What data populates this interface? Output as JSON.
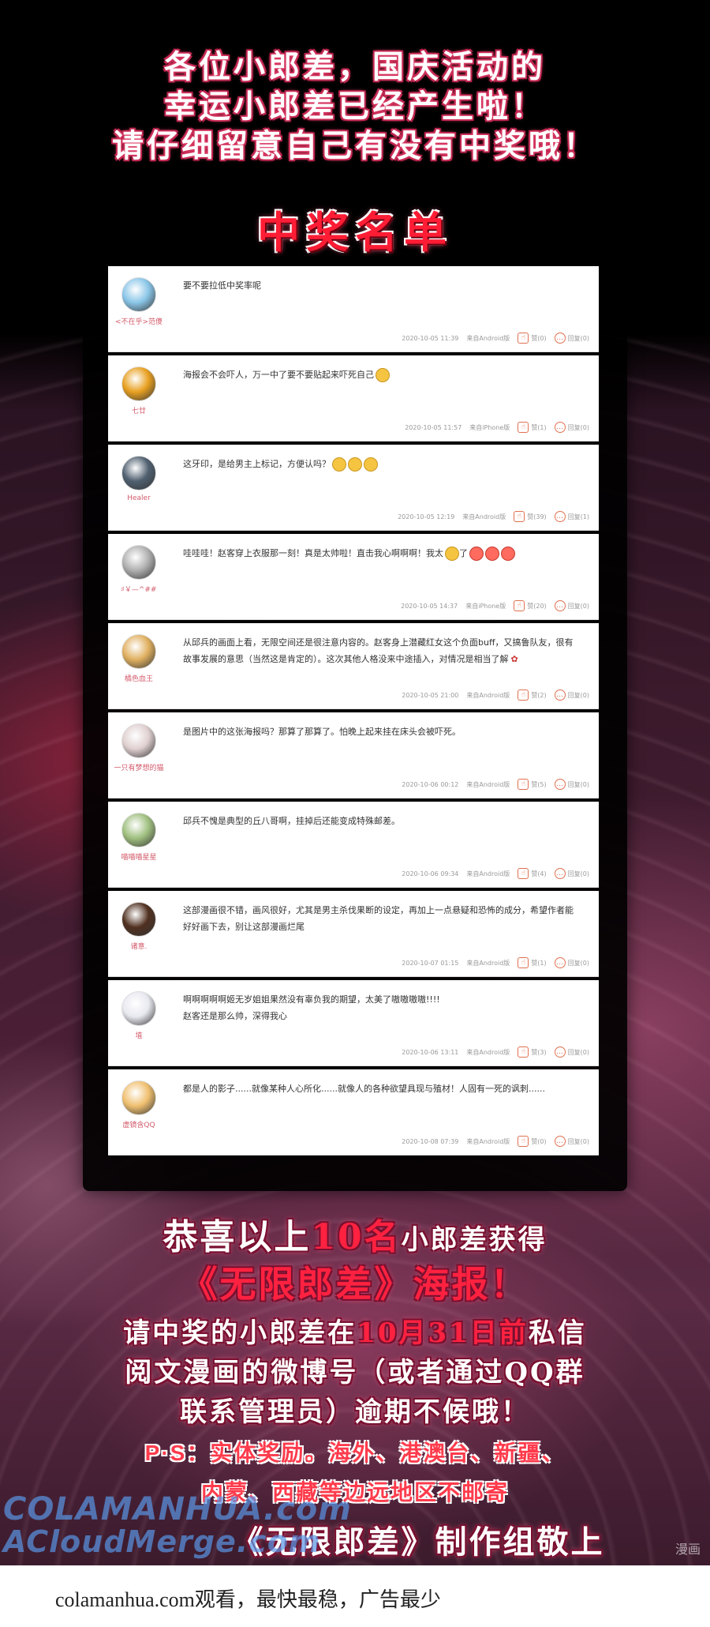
{
  "header": {
    "line1": "各位小郎差，国庆活动的",
    "line2": "幸运小郎差已经产生啦！",
    "line3": "请仔细留意自己有没有中奖哦！",
    "winners_title": "中奖名单"
  },
  "comments": [
    {
      "user": "<不在乎>范傻",
      "text": "要不要拉低中奖率呢",
      "time": "2020-10-05 11:39",
      "source": "来自Android版",
      "likes": "赞(0)",
      "replies": "回复(0)",
      "avatar_color": "#8ac6e8"
    },
    {
      "user": "七廿",
      "text": "海报会不会吓人，万一中了要不要贴起来吓死自己",
      "time": "2020-10-05 11:57",
      "source": "来自iPhone版",
      "likes": "赞(1)",
      "replies": "回复(0)",
      "avatar_color": "#e8a020"
    },
    {
      "user": "Healer",
      "text": "这牙印，是给男主上标记，方便认吗？",
      "time": "2020-10-05 12:19",
      "source": "来自Android版",
      "likes": "赞(39)",
      "replies": "回复(1)",
      "avatar_color": "#506070"
    },
    {
      "user": "♯￥—^##",
      "text": "哇哇哇！赵客穿上衣服那一刻！真是太帅啦！直击我心啊啊啊！我太",
      "text2": "了",
      "time": "2020-10-05 14:37",
      "source": "来自iPhone版",
      "likes": "赞(20)",
      "replies": "回复(0)",
      "avatar_color": "#b0b0b0"
    },
    {
      "user": "橘色血王",
      "text": "从邱兵的画面上看，无限空间还是很注意内容的。赵客身上潜藏红女这个负面buff，又搞鲁队友，很有故事发展的意思（当然这是肯定的）。这次其他人格没来中途插入，对情况是相当了解",
      "time": "2020-10-05 21:00",
      "source": "来自Android版",
      "likes": "赞(2)",
      "replies": "回复(0)",
      "avatar_color": "#e0b060"
    },
    {
      "user": "一只有梦想的猫",
      "text": "是图片中的这张海报吗？那算了那算了。怕晚上起来挂在床头会被吓死。",
      "time": "2020-10-06 00:12",
      "source": "来自Android版",
      "likes": "赞(5)",
      "replies": "回复(0)",
      "avatar_color": "#e0d0d0"
    },
    {
      "user": "喵喵喵星星",
      "text": "邱兵不愧是典型的丘八哥啊，挂掉后还能变成特殊邮差。",
      "time": "2020-10-06 09:34",
      "source": "来自Android版",
      "likes": "赞(4)",
      "replies": "回复(0)",
      "avatar_color": "#a0c080"
    },
    {
      "user": "诸意.",
      "text": "这部漫画很不错，画风很好，尤其是男主杀伐果断的设定，再加上一点悬疑和恐怖的成分，希望作者能好好画下去，别让这部漫画烂尾",
      "time": "2020-10-07 01:15",
      "source": "来自Android版",
      "likes": "赞(1)",
      "replies": "回复(0)",
      "avatar_color": "#503020"
    },
    {
      "user": "埴",
      "text": "啊啊啊啊啊姬无岁姐姐果然没有辜负我的期望，太美了嗷嗷嗷嗷!!!!",
      "text2": "赵客还是那么帅，深得我心",
      "time": "2020-10-06 13:11",
      "source": "来自Android版",
      "likes": "赞(3)",
      "replies": "回复(0)",
      "avatar_color": "#e8e8f0"
    },
    {
      "user": "虚镜含QQ",
      "text": "都是人的影子......就像某种人心所化......就像人的各种欲望具现与殖材！人固有一死的讽刺......",
      "time": "2020-10-08 07:39",
      "source": "来自Android版",
      "likes": "赞(0)",
      "replies": "回复(0)",
      "avatar_color": "#f0c070"
    }
  ],
  "congrats": {
    "line1a": "恭喜以上",
    "line1b": "10名",
    "line1c": "小郎差获得",
    "line2": "《无限郎差》海报！",
    "line3a": "请中奖的小郎差在",
    "line3b": "10月31日前",
    "line3c": "私信",
    "line4": "阅文漫画的微博号（或者通过QQ群",
    "line5": "联系管理员）逾期不候哦！",
    "ps1": "P·S：实体奖励。海外、港澳台、新疆、",
    "ps2": "内蒙、西藏等边远地区不邮寄",
    "signature": "《无限郎差》制作组敬上"
  },
  "watermark": {
    "line1": "COLAMANHUA.com",
    "line2": "ACloudMerge.com",
    "corner": "漫画"
  },
  "footer": {
    "text": "colamanhua.com观看，最快最稳，广告最少"
  }
}
